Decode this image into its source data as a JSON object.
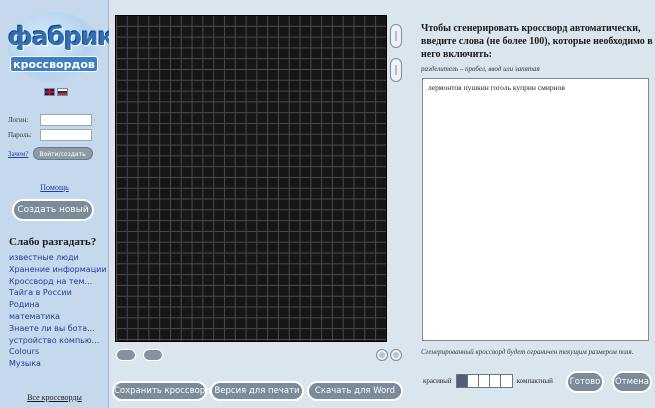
{
  "sidebar": {
    "logo": {
      "top": "фабрика",
      "bottom": "кроссвордов"
    },
    "flags": [
      "uk-flag-icon",
      "ru-flag-icon"
    ],
    "login_label": "Логин:",
    "password_label": "Пароль:",
    "enter_link": "Зачем?",
    "enter_button": "Войти/создать",
    "help_link": "Помощь",
    "create_button": "Создать новый",
    "weak_title": "Слабо разгадать?",
    "topics": [
      "известные люди",
      "Хранение информации",
      "Кроссворд на тем...",
      "Тайга в России",
      "Родина",
      "математика",
      "Знаете ли вы бота...",
      "устройство компью...",
      "Colours",
      "Музыка"
    ],
    "all_link": "Все кроссворды"
  },
  "grid": {
    "bottom_buttons": {
      "save": "Сохранить кроссворд",
      "print": "Версия для печати",
      "word": "Скачать для Word"
    }
  },
  "panel": {
    "title": "Чтобы сгенерировать кроссворд автоматически, введите слова (не более 100), которые необходимо в него включить:",
    "hint": "разделитель – пробел, ввод или запятая",
    "words": "лермонтов пушкин гоголь куприн смирнов",
    "footnote": "Сгенерированный кроссворд будет ограничен текущим размером поля.",
    "density_left": "красивый",
    "density_right": "компактный",
    "density_level": 0.2,
    "ready_button": "Готово",
    "cancel_button": "Отмена"
  },
  "colors": {
    "sidebar_bg": "#c5d8ec",
    "panel_bg": "#dbe5ee",
    "grid_bg": "#161616",
    "button_bg": "#7b8b9a",
    "link": "#1f3e9e"
  }
}
